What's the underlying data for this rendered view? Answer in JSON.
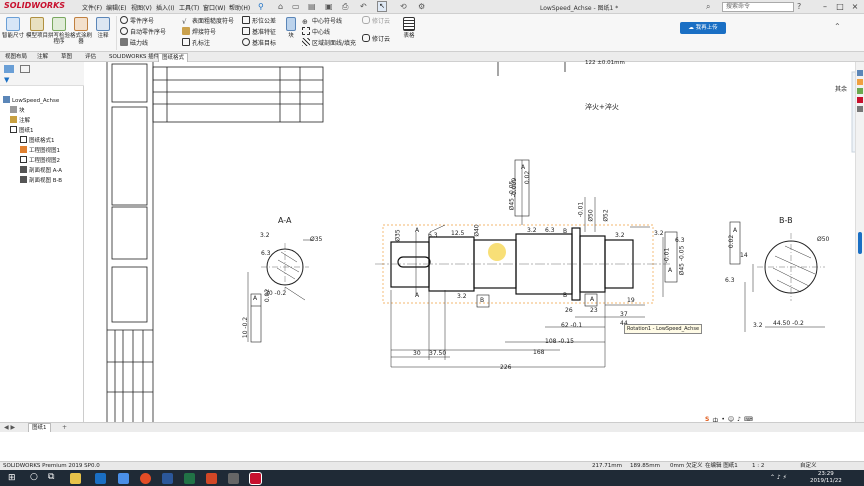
{
  "app": {
    "logo": "SOLIDWORKS",
    "document_title": "LowSpeed_Achse - 图纸1 *",
    "search_placeholder": "搜索命令",
    "menu": [
      "文件(F)",
      "编辑(E)",
      "视图(V)",
      "插入(I)",
      "工具(T)",
      "窗口(W)",
      "帮助(H)"
    ]
  },
  "ribbon": {
    "big_buttons": [
      "智能尺寸",
      "模型项目",
      "拼写检验程序",
      "格式涂刷器",
      "注释"
    ],
    "col1": [
      "零件序号",
      "自动零件序号",
      "磁力线"
    ],
    "col2": [
      "表面粗糙度符号",
      "焊接符号",
      "孔标注"
    ],
    "col3": [
      "形位公差",
      "基准特征",
      "基准目标"
    ],
    "block_label": "块",
    "col4": [
      "中心符号线",
      "中心线",
      "区域剖面线/填充"
    ],
    "col5": [
      "修订云"
    ],
    "table_label": "表格",
    "upload_label": "我再上传"
  },
  "tabs": [
    "视图布局",
    "注解",
    "草图",
    "评估",
    "SOLIDWORKS 插件",
    "图纸格式"
  ],
  "active_tab": 5,
  "tree": {
    "root": "LowSpeed_Achse",
    "items": [
      "块",
      "注解",
      "图纸1",
      "图纸格式1",
      "工程图视图1",
      "工程图视图2",
      "剖面视图 A-A",
      "剖面视图 B-B"
    ]
  },
  "drawing": {
    "top_note": "122 ±0.01mm",
    "heat_note": "淬火+淬火",
    "section_a": "A-A",
    "section_b": "B-B",
    "corner_text": "其余",
    "tooltip": "Rotation1 - LowSpeed_Achse",
    "dims": {
      "d35": "Ø35",
      "d50": "Ø50",
      "d40": "Ø40",
      "d45": "Ø45 -0.05",
      "d52": "Ø52",
      "len30": "30",
      "len37_50": "37.50",
      "len168": "168",
      "len226": "226",
      "len108": "108 -0.15",
      "len62": "62 -0.1",
      "len26": "26",
      "len23": "23",
      "len37": "37",
      "len44": "44",
      "len19": "19",
      "len10": "10 -0.2",
      "len30a": "30 -0.2",
      "len44_50": "44.50 -0.2",
      "rough_63": "6.3",
      "rough_32": "3.2",
      "rough_125": "12.5",
      "tol_002": "0.02",
      "tol_009": "-0.009",
      "tol_001": "-0.01",
      "label_a": "A",
      "label_b": "B"
    }
  },
  "sheet_tab": "图纸1",
  "status": {
    "app_version": "SOLIDWORKS Premium 2019 SP0.0",
    "x": "217.71mm",
    "y": "189.85mm",
    "z": "0mm 欠定义",
    "mode": "在编辑 图纸1",
    "scale": "1 : 2",
    "custom": "自定义"
  },
  "clock": {
    "time": "23:29",
    "date": "2019/11/22"
  },
  "colors": {
    "brand": "#c8102e",
    "accent": "#1a6fc4",
    "selection": "#f0a040"
  }
}
